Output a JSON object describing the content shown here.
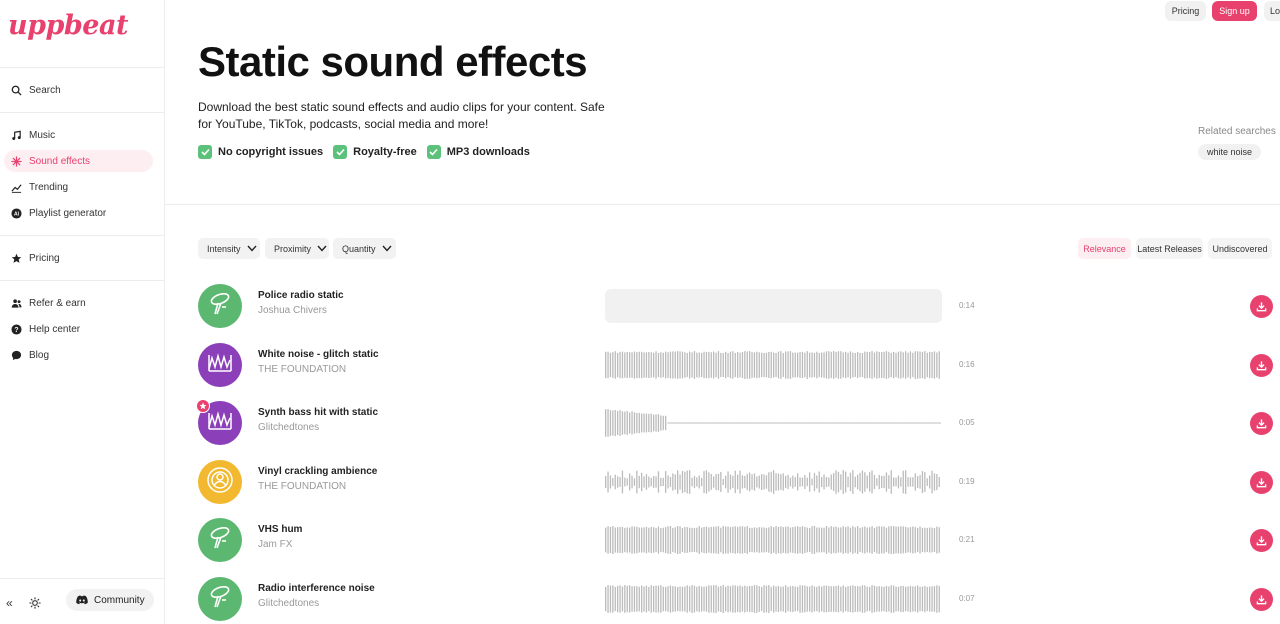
{
  "brand": {
    "logo": "uppbeat",
    "accent": "#e8416e"
  },
  "sidebar": {
    "search": "Search",
    "items": [
      {
        "label": "Music",
        "icon": "music-note-icon"
      },
      {
        "label": "Sound effects",
        "icon": "sound-effects-icon",
        "active": true
      },
      {
        "label": "Trending",
        "icon": "trending-icon"
      },
      {
        "label": "Playlist generator",
        "icon": "ai-icon"
      },
      {
        "label": "Pricing",
        "icon": "star-icon"
      },
      {
        "label": "Refer & earn",
        "icon": "users-icon"
      },
      {
        "label": "Help center",
        "icon": "help-icon"
      },
      {
        "label": "Blog",
        "icon": "chat-icon"
      }
    ],
    "community": "Community"
  },
  "topbar": {
    "pricing": "Pricing",
    "signup": "Sign up",
    "login": "Lo"
  },
  "header": {
    "title": "Static sound effects",
    "description": "Download the best static sound effects and audio clips for your content. Safe for YouTube, TikTok, podcasts, social media and more!",
    "features": [
      "No copyright issues",
      "Royalty-free",
      "MP3 downloads"
    ],
    "related_label": "Related searches",
    "related_tags": [
      "white noise"
    ]
  },
  "filters": [
    "Intensity",
    "Proximity",
    "Quantity"
  ],
  "sort": {
    "options": [
      "Relevance",
      "Latest Releases",
      "Undiscovered"
    ],
    "active": "Relevance"
  },
  "tracks": [
    {
      "title": "Police radio static",
      "artist": "Joshua Chivers",
      "duration": "0:14",
      "color": "#5cb870",
      "icon": "microphone-icon",
      "wave": "loading"
    },
    {
      "title": "White noise - glitch static",
      "artist": "THE FOUNDATION",
      "duration": "0:16",
      "color": "#8b3fb8",
      "icon": "waveform-icon",
      "wave": "dense"
    },
    {
      "title": "Synth bass hit with static",
      "artist": "Glitchedtones",
      "duration": "0:05",
      "color": "#8b3fb8",
      "icon": "waveform-icon",
      "wave": "decay",
      "badge": true
    },
    {
      "title": "Vinyl crackling ambience",
      "artist": "THE FOUNDATION",
      "duration": "0:19",
      "color": "#f2b830",
      "icon": "target-icon",
      "wave": "sparse"
    },
    {
      "title": "VHS hum",
      "artist": "Jam FX",
      "duration": "0:21",
      "color": "#5cb870",
      "icon": "microphone-icon",
      "wave": "dense"
    },
    {
      "title": "Radio interference noise",
      "artist": "Glitchedtones",
      "duration": "0:07",
      "color": "#5cb870",
      "icon": "microphone-icon",
      "wave": "dense"
    }
  ]
}
